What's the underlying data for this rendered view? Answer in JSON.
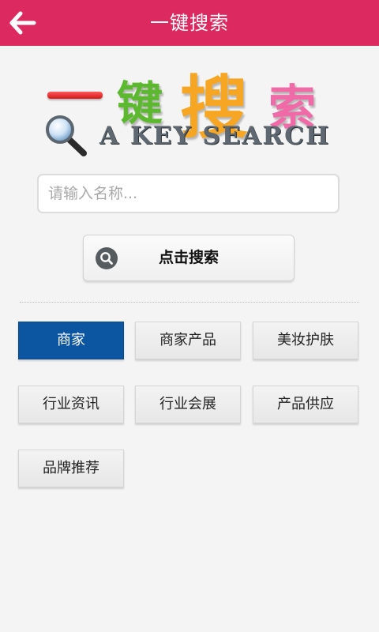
{
  "header": {
    "title": "一键搜索",
    "back_icon": "back-arrow-icon",
    "background_color": "#dc2a60"
  },
  "logo": {
    "chars": [
      "一",
      "键",
      "搜",
      "索"
    ],
    "english": "A KEY SEARCH",
    "icon": "magnifier-icon"
  },
  "search": {
    "placeholder": "请输入名称...",
    "value": "",
    "button_label": "点击搜索",
    "button_icon": "search-icon"
  },
  "categories": [
    {
      "label": "商家",
      "active": true
    },
    {
      "label": "商家产品",
      "active": false
    },
    {
      "label": "美妆护肤",
      "active": false
    },
    {
      "label": "行业资讯",
      "active": false
    },
    {
      "label": "行业会展",
      "active": false
    },
    {
      "label": "产品供应",
      "active": false
    },
    {
      "label": "品牌推荐",
      "active": false
    }
  ],
  "colors": {
    "accent": "#dc2a60",
    "active_category": "#0c55a0"
  }
}
